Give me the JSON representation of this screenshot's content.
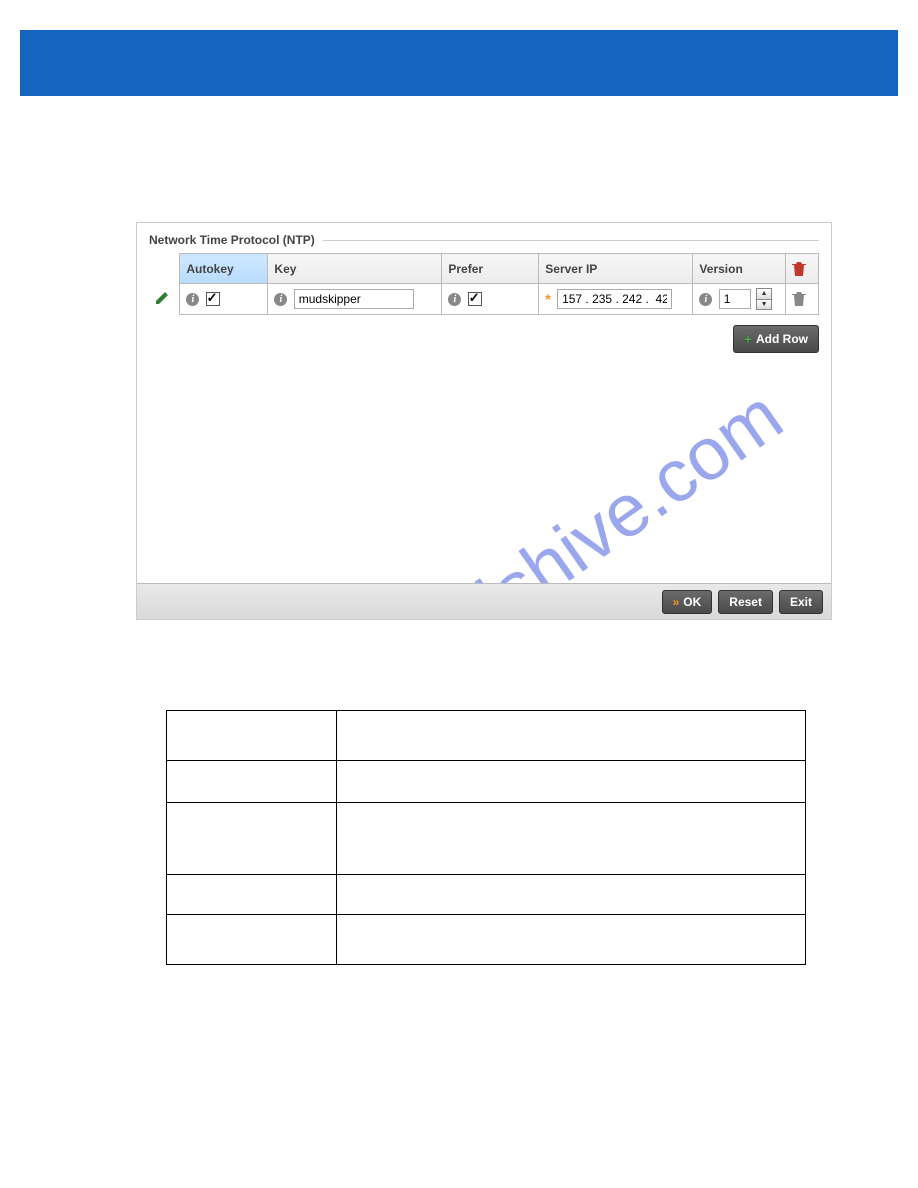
{
  "panel": {
    "title": "Network Time Protocol (NTP)",
    "columns": {
      "autokey": "Autokey",
      "key": "Key",
      "prefer": "Prefer",
      "server_ip": "Server IP",
      "version": "Version"
    },
    "row": {
      "autokey_checked": true,
      "key_value": "mudskipper",
      "prefer_checked": true,
      "server_ip_value": "157 . 235 . 242 .  42",
      "version_value": "1"
    },
    "add_row_label": "Add Row"
  },
  "footer": {
    "ok": "OK",
    "reset": "Reset",
    "exit": "Exit"
  },
  "watermark": "manualshive.com"
}
